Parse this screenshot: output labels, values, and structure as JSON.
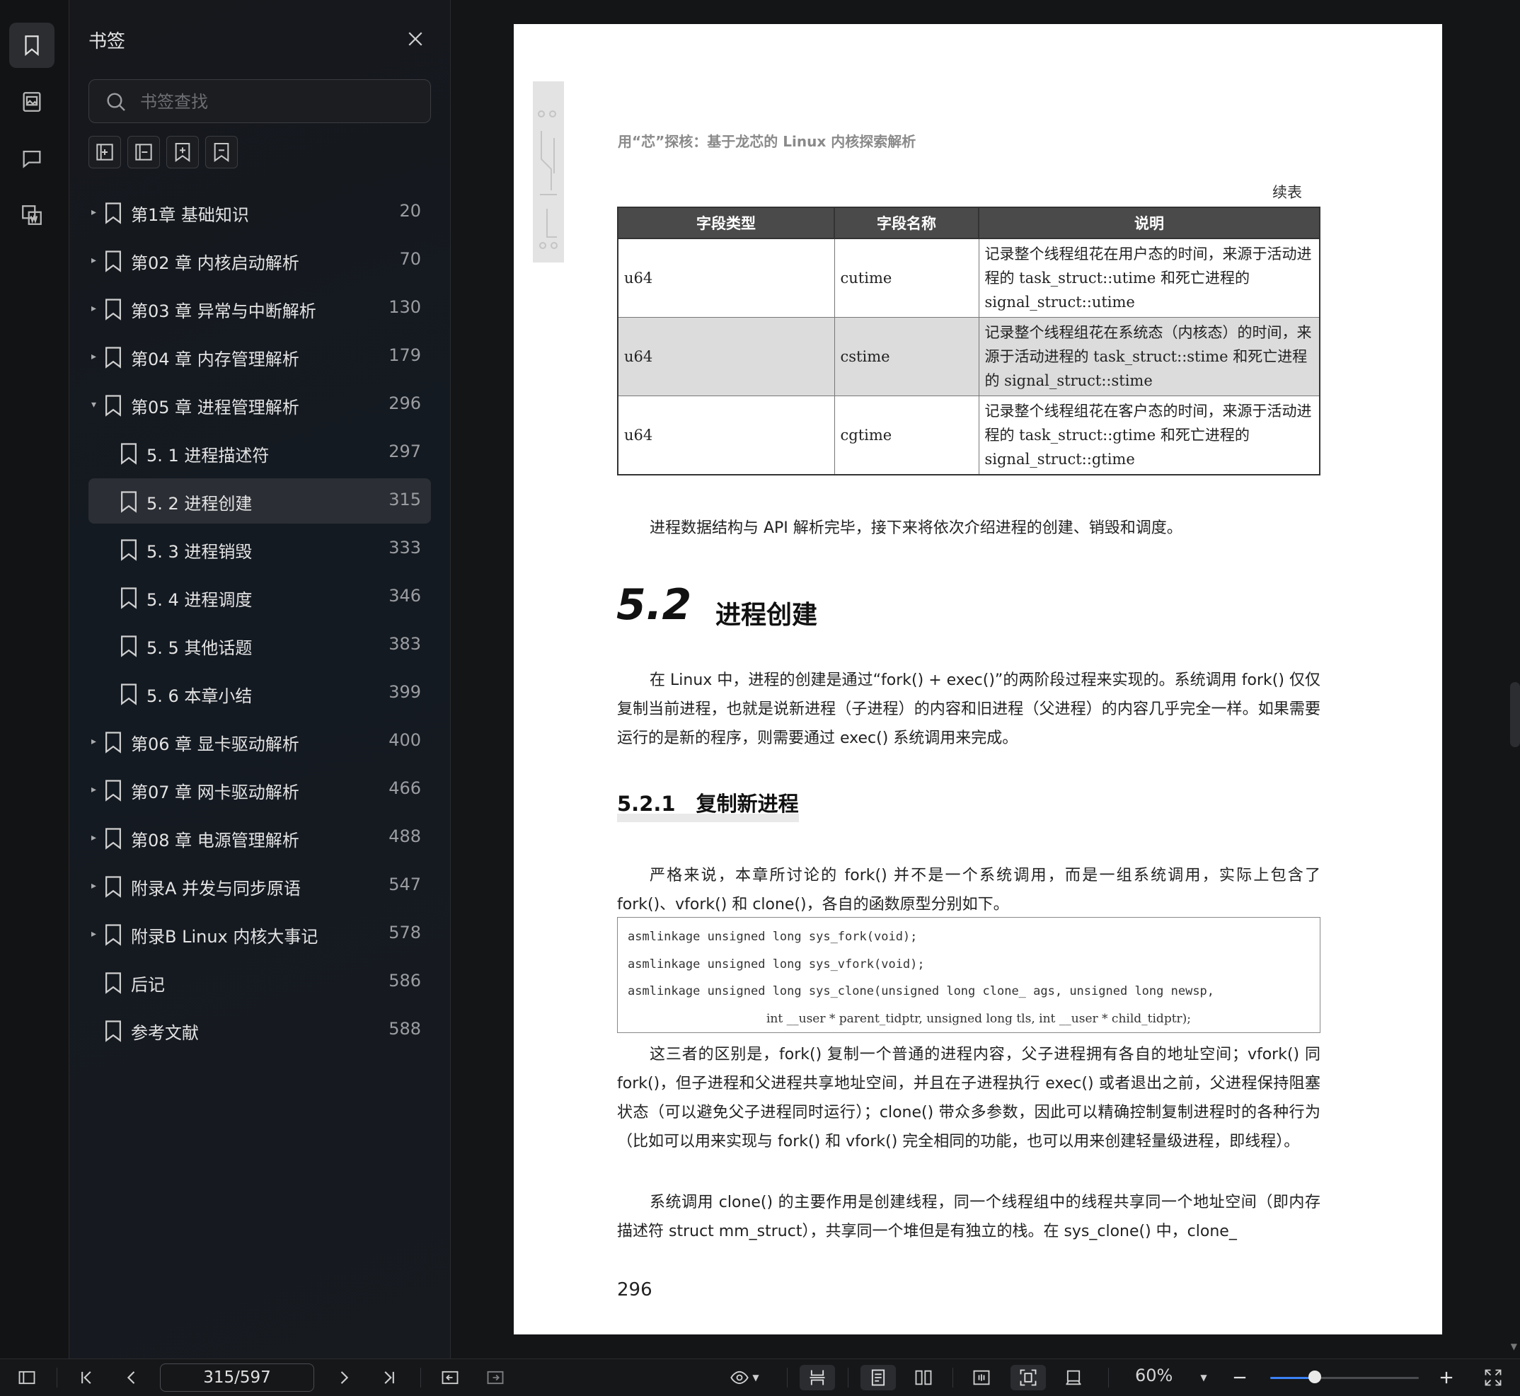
{
  "sidebar": {
    "title": "书签",
    "search_placeholder": "书签查找",
    "items": [
      {
        "label": "第1章 基础知识",
        "page": "20",
        "level": 0,
        "expander": "▸"
      },
      {
        "label": "第02 章 内核启动解析",
        "page": "70",
        "level": 0,
        "expander": "▸"
      },
      {
        "label": "第03 章 异常与中断解析",
        "page": "130",
        "level": 0,
        "expander": "▸"
      },
      {
        "label": "第04 章 内存管理解析",
        "page": "179",
        "level": 0,
        "expander": "▸"
      },
      {
        "label": "第05 章 进程管理解析",
        "page": "296",
        "level": 0,
        "expander": "▾"
      },
      {
        "label": "5. 1 进程描述符",
        "page": "297",
        "level": 1,
        "expander": ""
      },
      {
        "label": "5. 2 进程创建",
        "page": "315",
        "level": 1,
        "expander": "",
        "selected": true
      },
      {
        "label": "5. 3 进程销毁",
        "page": "333",
        "level": 1,
        "expander": ""
      },
      {
        "label": "5. 4 进程调度",
        "page": "346",
        "level": 1,
        "expander": ""
      },
      {
        "label": "5. 5 其他话题",
        "page": "383",
        "level": 1,
        "expander": ""
      },
      {
        "label": "5. 6 本章小结",
        "page": "399",
        "level": 1,
        "expander": ""
      },
      {
        "label": "第06 章 显卡驱动解析",
        "page": "400",
        "level": 0,
        "expander": "▸"
      },
      {
        "label": "第07 章 网卡驱动解析",
        "page": "466",
        "level": 0,
        "expander": "▸"
      },
      {
        "label": "第08 章 电源管理解析",
        "page": "488",
        "level": 0,
        "expander": "▸"
      },
      {
        "label": "附录A 并发与同步原语",
        "page": "547",
        "level": 0,
        "expander": "▸"
      },
      {
        "label": "附录B Linux 内核大事记",
        "page": "578",
        "level": 0,
        "expander": "▸"
      },
      {
        "label": "后记",
        "page": "586",
        "level": 0,
        "expander": ""
      },
      {
        "label": "参考文献",
        "page": "588",
        "level": 0,
        "expander": ""
      }
    ]
  },
  "document": {
    "running_head": "用“芯”探核：基于龙芯的 Linux 内核探索解析",
    "continued": "续表",
    "table": {
      "headers": [
        "字段类型",
        "字段名称",
        "说明"
      ],
      "rows": [
        [
          "u64",
          "cutime",
          "记录整个线程组花在用户态的时间，来源于活动进程的 task_struct::utime 和死亡进程的 signal_struct::utime"
        ],
        [
          "u64",
          "cstime",
          "记录整个线程组花在系统态（内核态）的时间，来源于活动进程的 task_struct::stime 和死亡进程的 signal_struct::stime"
        ],
        [
          "u64",
          "cgtime",
          "记录整个线程组花在客户态的时间，来源于活动进程的 task_struct::gtime 和死亡进程的 signal_struct::gtime"
        ]
      ]
    },
    "para1": "进程数据结构与 API 解析完毕，接下来将依次介绍进程的创建、销毁和调度。",
    "section_num": "5.2",
    "section_title": "进程创建",
    "para2": "在 Linux 中，进程的创建是通过“fork() + exec()”的两阶段过程来实现的。系统调用 fork() 仅仅复制当前进程，也就是说新进程（子进程）的内容和旧进程（父进程）的内容几乎完全一样。如果需要运行的是新的程序，则需要通过 exec() 系统调用来完成。",
    "subsection": "5.2.1　复制新进程",
    "para3": "严格来说，本章所讨论的 fork() 并不是一个系统调用，而是一组系统调用，实际上包含了 fork()、vfork() 和 clone()，各自的函数原型分别如下。",
    "code": [
      "asmlinkage unsigned long sys_fork(void);",
      "asmlinkage unsigned long sys_vfork(void);",
      "asmlinkage unsigned long sys_clone(unsigned long clone_ ags, unsigned long newsp,",
      "int __user * parent_tidptr, unsigned long tls, int __user * child_tidptr);"
    ],
    "para4": "这三者的区别是，fork() 复制一个普通的进程内容，父子进程拥有各自的地址空间；vfork() 同 fork()，但子进程和父进程共享地址空间，并且在子进程执行 exec() 或者退出之前，父进程保持阻塞状态（可以避免父子进程同时运行）；clone() 带众多参数，因此可以精确控制复制进程时的各种行为（比如可以用来实现与 fork() 和 vfork() 完全相同的功能，也可以用来创建轻量级进程，即线程）。",
    "para5": "系统调用 clone() 的主要作用是创建线程，同一个线程组中的线程共享同一个地址空间（即内存描述符 struct mm_struct），共享同一个堆但是有独立的栈。在 sys_clone() 中，clone_",
    "page_number": "296"
  },
  "toolbar": {
    "page_indicator": "315/597",
    "zoom": "60%",
    "zoom_fraction": 0.3
  },
  "colors": {
    "accent": "#3b82f6",
    "selected_row": "#2b2e34"
  }
}
